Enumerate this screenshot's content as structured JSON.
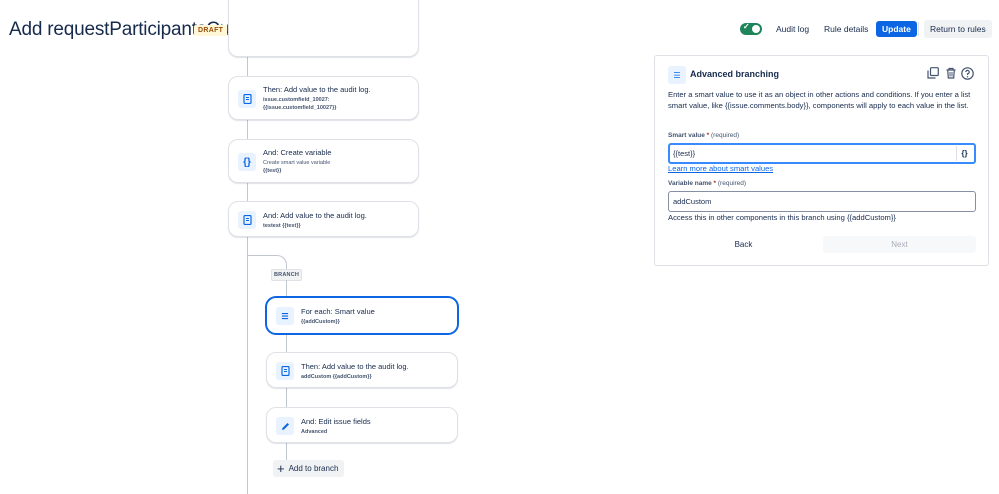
{
  "header": {
    "title": "Add requestParticipantsCustom",
    "badge": "DRAFT",
    "audit_log": "Audit log",
    "rule_details": "Rule details",
    "update": "Update",
    "return_to_rules": "Return to rules"
  },
  "flow": {
    "cards": [
      {
        "title": "Then: Add value to the audit log.",
        "sub1": "issue.customfield_10027:",
        "sub2": "{{issue.customfield_10027}}",
        "icon": "document-icon"
      },
      {
        "title": "And: Create variable",
        "sub1": "Create smart value variable",
        "sub2": "{{test}}",
        "icon": "braces-icon"
      },
      {
        "title": "And: Add value to the audit log.",
        "sub1": "testest {{test}}",
        "icon": "document-icon"
      }
    ],
    "branch_label": "BRANCH",
    "branch_cards": [
      {
        "title": "For each: Smart value",
        "sub1": "{{addCustom}}",
        "icon": "list-icon"
      },
      {
        "title": "Then: Add value to the audit log.",
        "sub1": "addCustom {{addCustom}}",
        "icon": "document-icon"
      },
      {
        "title": "And: Edit issue fields",
        "sub1": "Advanced",
        "icon": "pencil-icon"
      }
    ],
    "add_to_branch": "Add to branch"
  },
  "panel": {
    "title": "Advanced branching",
    "description": "Enter a smart value to use it as an object in other actions and conditions. If you enter a list smart value, like {{issue.comments.body}}, components will apply to each value in the list.",
    "smart_value_label": "Smart value",
    "required_marker": "*",
    "required_text": "(required)",
    "smart_value": "{{test}}",
    "brace_button": "{}",
    "learn_more": "Learn more about smart values",
    "variable_name_label": "Variable name",
    "variable_name": "addCustom",
    "help_text": "Access this in other components in this branch using {{addCustom}}",
    "back": "Back",
    "next": "Next"
  },
  "colors": {
    "primary": "#0c66e4",
    "toggle_on": "#1f845a"
  }
}
